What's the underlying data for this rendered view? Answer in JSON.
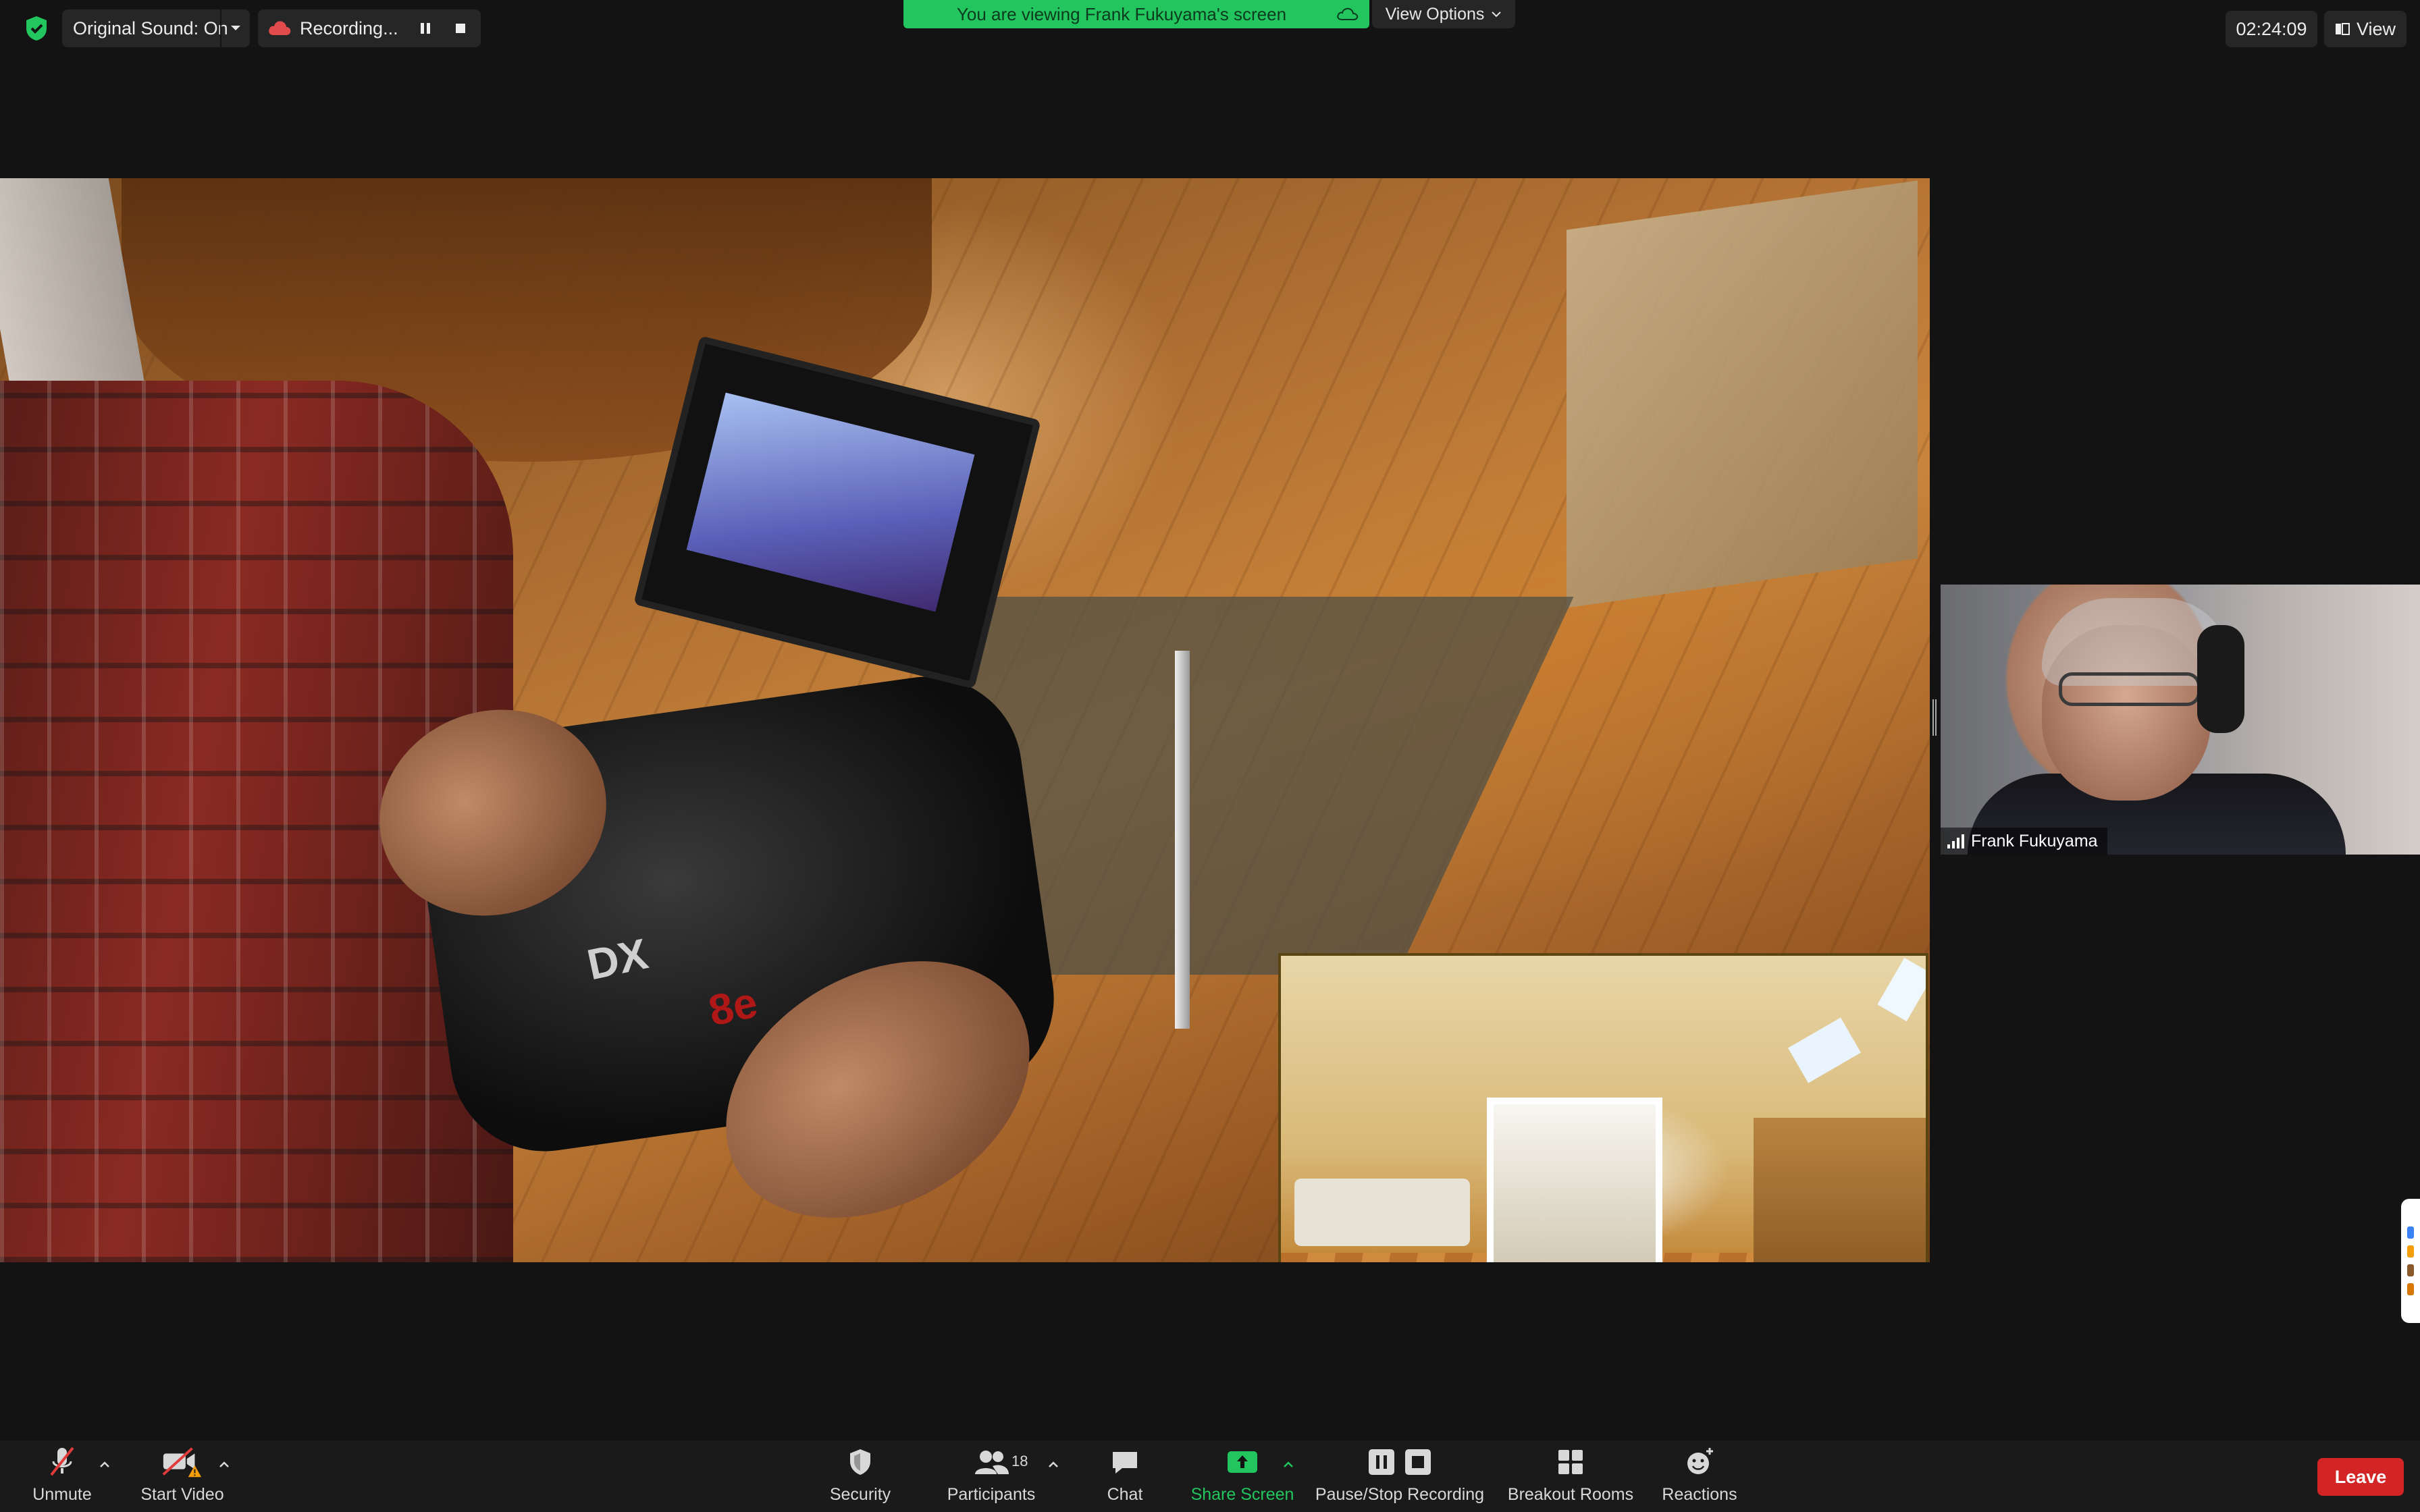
{
  "topbar": {
    "original_sound": "Original Sound: On",
    "recording": "Recording...",
    "banner": "You are viewing Frank Fukuyama's screen",
    "view_options": "View Options",
    "timer": "02:24:09",
    "view": "View"
  },
  "participant": {
    "name": "Frank Fukuyama"
  },
  "shared_screen": {
    "controller_brand": "DX",
    "controller_model": "8e"
  },
  "toolbar": {
    "unmute": "Unmute",
    "start_video": "Start Video",
    "security": "Security",
    "participants": "Participants",
    "participants_count": "18",
    "chat": "Chat",
    "share_screen": "Share Screen",
    "pause_stop_recording": "Pause/Stop Recording",
    "breakout_rooms": "Breakout Rooms",
    "reactions": "Reactions",
    "leave": "Leave"
  },
  "colors": {
    "share_green": "#22c55e",
    "leave_red": "#d32525",
    "warning_orange": "#f59e0b"
  }
}
